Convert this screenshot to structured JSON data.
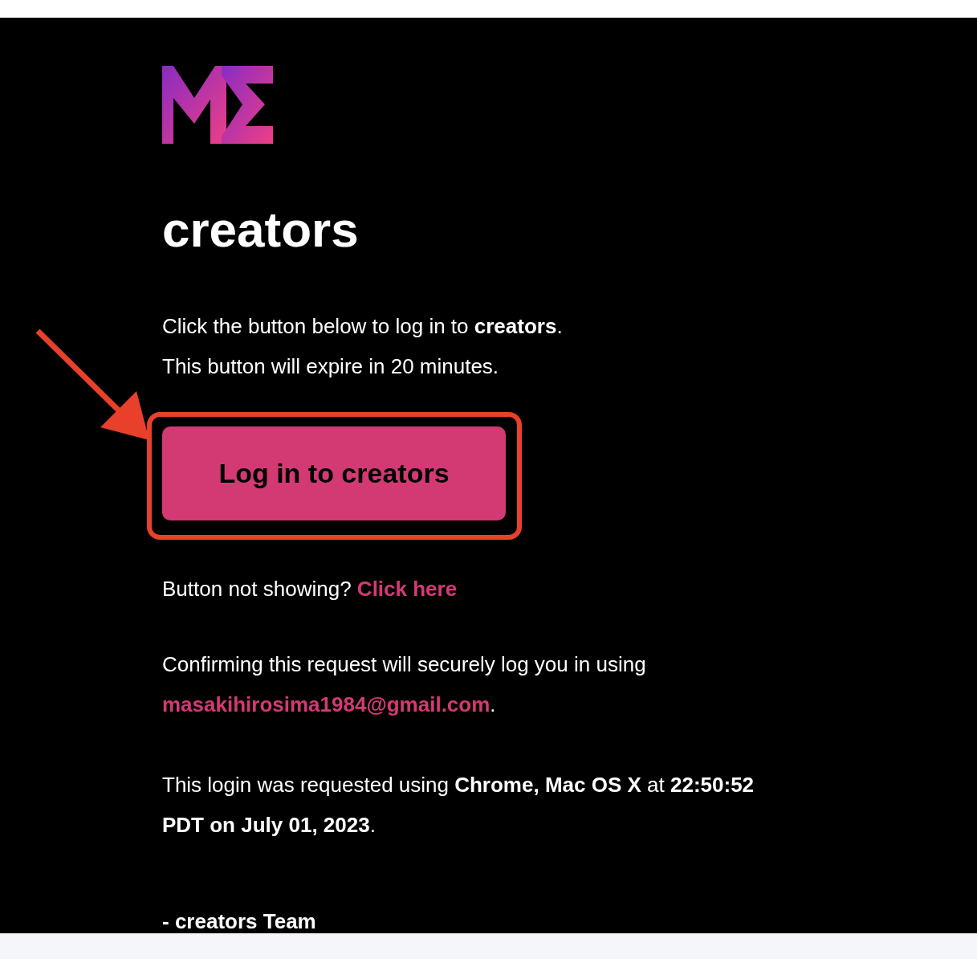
{
  "title": "creators",
  "intro": [
    "Click the button below to log in to **creators**.",
    "This button will expire in 20 minutes."
  ],
  "login_button": "Log in to creators",
  "fallback": {
    "text": "Button not showing?",
    "link": "Click here"
  },
  "confirm": {
    "text": "Confirming this request will securely log you in using",
    "email": "masakihirosima1984@gmail.com",
    "end": "."
  },
  "request_info": "This login was requested using **Chrome, Mac OS X** at **22:50:52 PDT on July 01, 2023**.",
  "signoff": "- creators Team"
}
